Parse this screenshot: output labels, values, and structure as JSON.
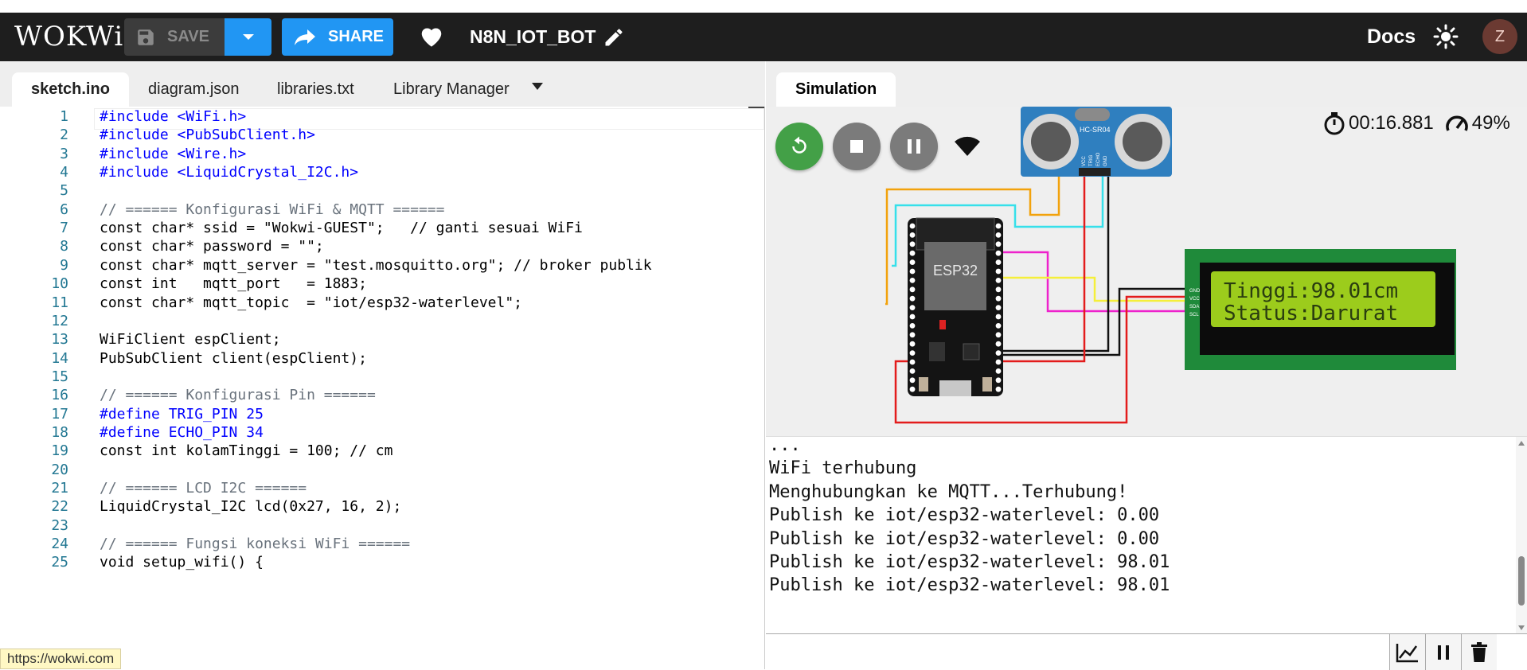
{
  "header": {
    "logo": "WOKWi",
    "save_label": "SAVE",
    "share_label": "SHARE",
    "project_name": "N8N_IOT_BOT",
    "docs_label": "Docs",
    "avatar_initial": "Z"
  },
  "editor_tabs": [
    {
      "label": "sketch.ino",
      "active": true
    },
    {
      "label": "diagram.json",
      "active": false
    },
    {
      "label": "libraries.txt",
      "active": false
    },
    {
      "label": "Library Manager",
      "active": false
    }
  ],
  "code": [
    {
      "n": "1",
      "text": "#include <WiFi.h>"
    },
    {
      "n": "2",
      "text": "#include <PubSubClient.h>"
    },
    {
      "n": "3",
      "text": "#include <Wire.h>"
    },
    {
      "n": "4",
      "text": "#include <LiquidCrystal_I2C.h>"
    },
    {
      "n": "5",
      "text": ""
    },
    {
      "n": "6",
      "text": "// ====== Konfigurasi WiFi & MQTT ======"
    },
    {
      "n": "7",
      "text": "const char* ssid = \"Wokwi-GUEST\";   // ganti sesuai WiFi"
    },
    {
      "n": "8",
      "text": "const char* password = \"\";"
    },
    {
      "n": "9",
      "text": "const char* mqtt_server = \"test.mosquitto.org\"; // broker publik"
    },
    {
      "n": "10",
      "text": "const int   mqtt_port   = 1883;"
    },
    {
      "n": "11",
      "text": "const char* mqtt_topic  = \"iot/esp32-waterlevel\";"
    },
    {
      "n": "12",
      "text": ""
    },
    {
      "n": "13",
      "text": "WiFiClient espClient;"
    },
    {
      "n": "14",
      "text": "PubSubClient client(espClient);"
    },
    {
      "n": "15",
      "text": ""
    },
    {
      "n": "16",
      "text": "// ====== Konfigurasi Pin ======"
    },
    {
      "n": "17",
      "text": "#define TRIG_PIN 25"
    },
    {
      "n": "18",
      "text": "#define ECHO_PIN 34"
    },
    {
      "n": "19",
      "text": "const int kolamTinggi = 100; // cm"
    },
    {
      "n": "20",
      "text": ""
    },
    {
      "n": "21",
      "text": "// ====== LCD I2C ======"
    },
    {
      "n": "22",
      "text": "LiquidCrystal_I2C lcd(0x27, 16, 2);"
    },
    {
      "n": "23",
      "text": ""
    },
    {
      "n": "24",
      "text": "// ====== Fungsi koneksi WiFi ======"
    },
    {
      "n": "25",
      "text": "void setup_wifi() {"
    }
  ],
  "status_url": "https://wokwi.com",
  "simulation": {
    "tab_label": "Simulation",
    "timer": "00:16.881",
    "speed": "49%",
    "esp_label": "ESP32",
    "sensor_label": "HC-SR04",
    "sensor_pins": [
      "VCC",
      "TRIG",
      "ECHO",
      "GND"
    ],
    "lcd_pins": [
      "GND",
      "VCC",
      "SDA",
      "SCL"
    ],
    "lcd_line1": "Tinggi:98.01cm",
    "lcd_line2": "Status:Darurat"
  },
  "serial_output": [
    "...",
    "WiFi terhubung",
    "Menghubungkan ke MQTT...Terhubung!",
    "Publish ke iot/esp32-waterlevel: 0.00",
    "Publish ke iot/esp32-waterlevel: 0.00",
    "Publish ke iot/esp32-waterlevel: 98.01",
    "Publish ke iot/esp32-waterlevel: 98.01"
  ],
  "colors": {
    "accent": "#2196f3",
    "restart": "#43a047",
    "lcd_bg": "#9ccc1c",
    "lcd_board": "#1f8a3a"
  }
}
